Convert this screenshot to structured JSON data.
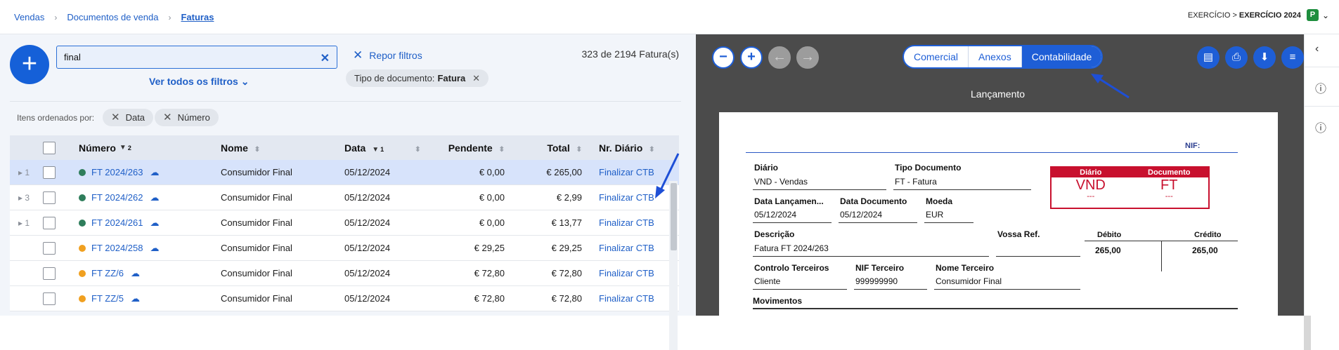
{
  "breadcrumb": [
    "Vendas",
    "Documentos de venda",
    "Faturas"
  ],
  "exercise": {
    "label": "EXERCÍCIO >",
    "value": "EXERCÍCIO 2024",
    "badge": "P"
  },
  "search": {
    "value": "final"
  },
  "reset_filters": "Repor filtros",
  "count_text": "323 de 2194 Fatura(s)",
  "view_all_filters": "Ver todos os filtros",
  "doc_type_chip": {
    "label": "Tipo de documento:",
    "value": "Fatura"
  },
  "order_label": "Itens ordenados por:",
  "order_chips": [
    "Data",
    "Número"
  ],
  "table": {
    "headers": {
      "numero": "Número",
      "numero_sort_index": "2",
      "nome": "Nome",
      "data": "Data",
      "data_sort_index": "1",
      "pendente": "Pendente",
      "total": "Total",
      "diario": "Nr. Diário"
    },
    "rows": [
      {
        "expand": "1",
        "status_color": "#2e7d5b",
        "numero": "FT 2024/263",
        "nome": "Consumidor Final",
        "data": "05/12/2024",
        "pendente": "€ 0,00",
        "total": "€ 265,00",
        "diario": "Finalizar CTB"
      },
      {
        "expand": "3",
        "status_color": "#2e7d5b",
        "numero": "FT 2024/262",
        "nome": "Consumidor Final",
        "data": "05/12/2024",
        "pendente": "€ 0,00",
        "total": "€ 2,99",
        "diario": "Finalizar CTB"
      },
      {
        "expand": "1",
        "status_color": "#2e7d5b",
        "numero": "FT 2024/261",
        "nome": "Consumidor Final",
        "data": "05/12/2024",
        "pendente": "€ 0,00",
        "total": "€ 13,77",
        "diario": "Finalizar CTB"
      },
      {
        "expand": "",
        "status_color": "#f0a020",
        "numero": "FT 2024/258",
        "nome": "Consumidor Final",
        "data": "05/12/2024",
        "pendente": "€ 29,25",
        "total": "€ 29,25",
        "diario": "Finalizar CTB"
      },
      {
        "expand": "",
        "status_color": "#f0a020",
        "numero": "FT ZZ/6",
        "nome": "Consumidor Final",
        "data": "05/12/2024",
        "pendente": "€ 72,80",
        "total": "€ 72,80",
        "diario": "Finalizar CTB"
      },
      {
        "expand": "",
        "status_color": "#f0a020",
        "numero": "FT ZZ/5",
        "nome": "Consumidor Final",
        "data": "05/12/2024",
        "pendente": "€ 72,80",
        "total": "€ 72,80",
        "diario": "Finalizar CTB"
      }
    ]
  },
  "viewer": {
    "tabs": [
      "Comercial",
      "Anexos",
      "Contabilidade"
    ],
    "active_tab": "Contabilidade",
    "heading": "Lançamento",
    "doc": {
      "nif_label": "NIF:",
      "diario_label": "Diário",
      "diario_value": "VND - Vendas",
      "tipo_label": "Tipo Documento",
      "tipo_value": "FT - Fatura",
      "box_diario_label": "Diário",
      "box_documento_label": "Documento",
      "box_diario_value": "VND",
      "box_documento_value": "FT",
      "box_dash": "---",
      "data_lanc_label": "Data Lançamen...",
      "data_lanc_value": "05/12/2024",
      "data_doc_label": "Data Documento",
      "data_doc_value": "05/12/2024",
      "moeda_label": "Moeda",
      "moeda_value": "EUR",
      "descricao_label": "Descrição",
      "descricao_value": "Fatura FT 2024/263",
      "vossa_ref_label": "Vossa Ref.",
      "debito_label": "Débito",
      "debito_value": "265,00",
      "credito_label": "Crédito",
      "credito_value": "265,00",
      "controlo_label": "Controlo Terceiros",
      "controlo_value": "Cliente",
      "nif_terceiro_label": "NIF Terceiro",
      "nif_terceiro_value": "999999990",
      "nome_terceiro_label": "Nome Terceiro",
      "nome_terceiro_value": "Consumidor Final",
      "movimentos_label": "Movimentos"
    }
  },
  "colors": {
    "accent": "#1e5ed6",
    "brand_red": "#c8102e",
    "success": "#2e7d5b",
    "warning": "#f0a020"
  }
}
